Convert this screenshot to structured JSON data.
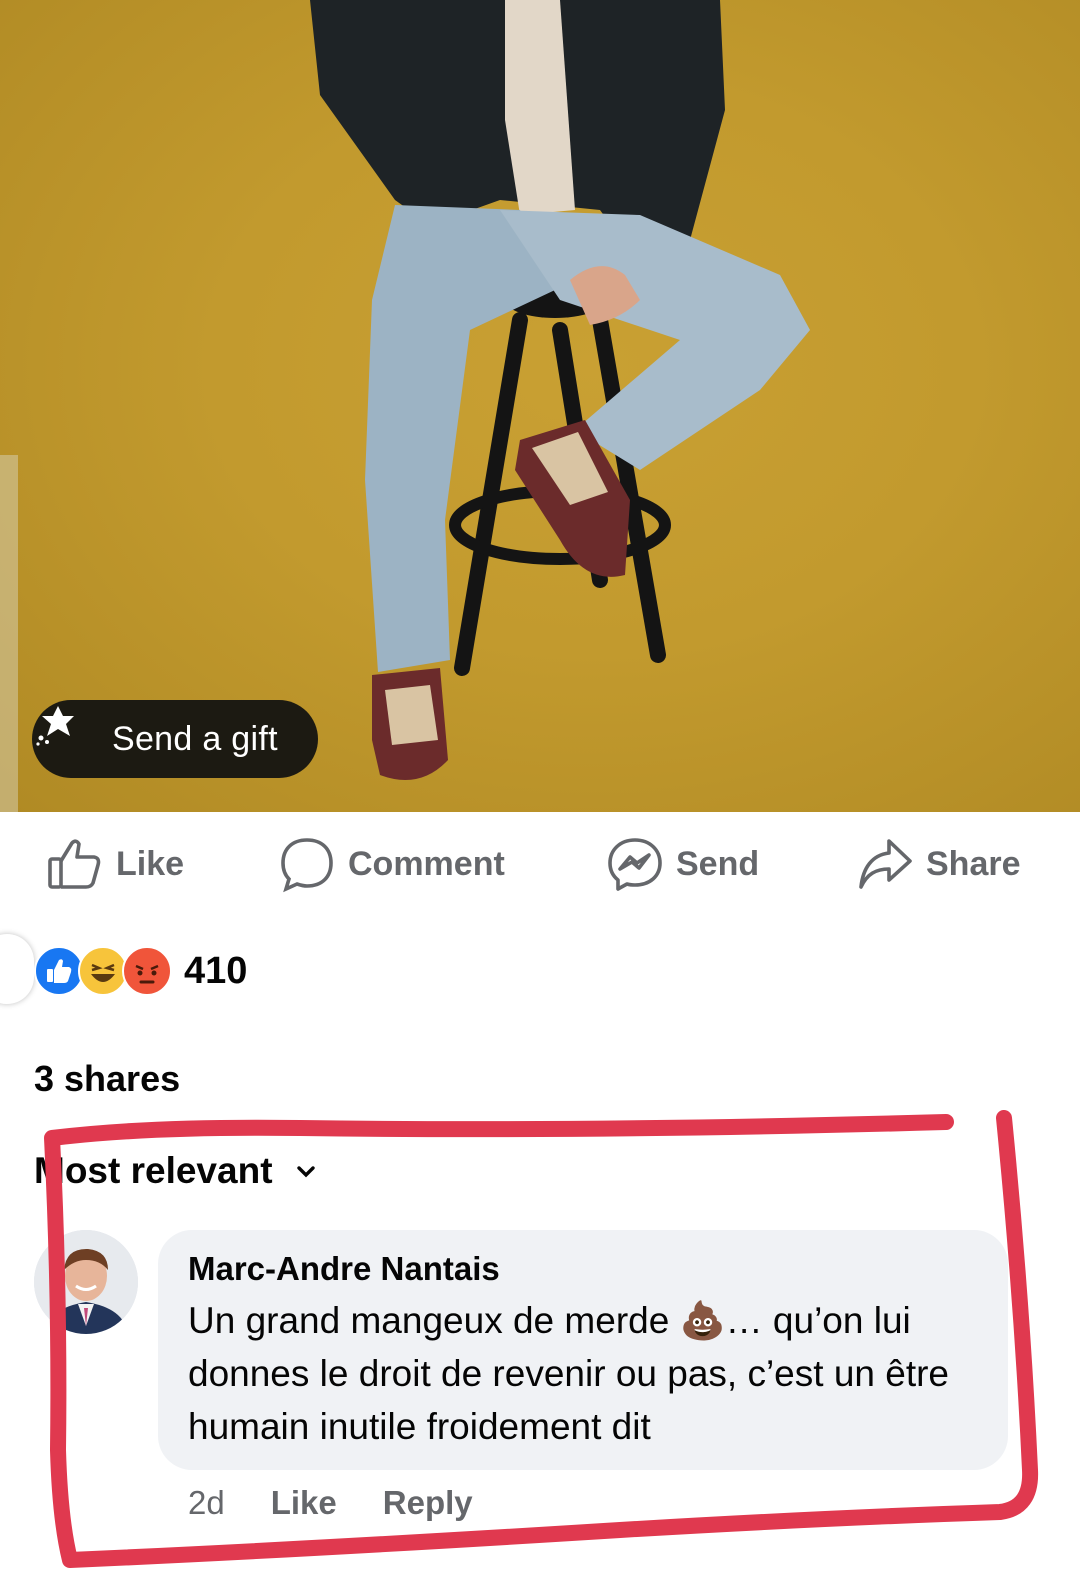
{
  "post": {
    "gift_button": {
      "label": "Send a gift",
      "icon": "gift-sparkle-icon"
    }
  },
  "actions": [
    {
      "label": "Like",
      "icon": "thumbs-up-outline-icon"
    },
    {
      "label": "Comment",
      "icon": "speech-bubble-icon"
    },
    {
      "label": "Send",
      "icon": "messenger-icon"
    },
    {
      "label": "Share",
      "icon": "share-arrow-icon"
    }
  ],
  "reactions": {
    "icons": [
      "like-reaction-icon",
      "haha-reaction-icon",
      "angry-reaction-icon"
    ],
    "count": "410"
  },
  "shares_text": "3 shares",
  "sort": {
    "label": "Most relevant",
    "icon": "chevron-down-icon"
  },
  "comment": {
    "author": "Marc-Andre Nantais",
    "text": "Un grand mangeux de merde 💩… qu’on lui donnes le droit de revenir ou pas, c’est un être humain inutile froidement dit",
    "time": "2d",
    "like_label": "Like",
    "reply_label": "Reply"
  },
  "colors": {
    "photo_background": "#c29a2e",
    "action_text": "#65676b",
    "bubble": "#f0f2f5",
    "annotation_stroke": "#e0394f",
    "like_blue": "#1877f2"
  }
}
